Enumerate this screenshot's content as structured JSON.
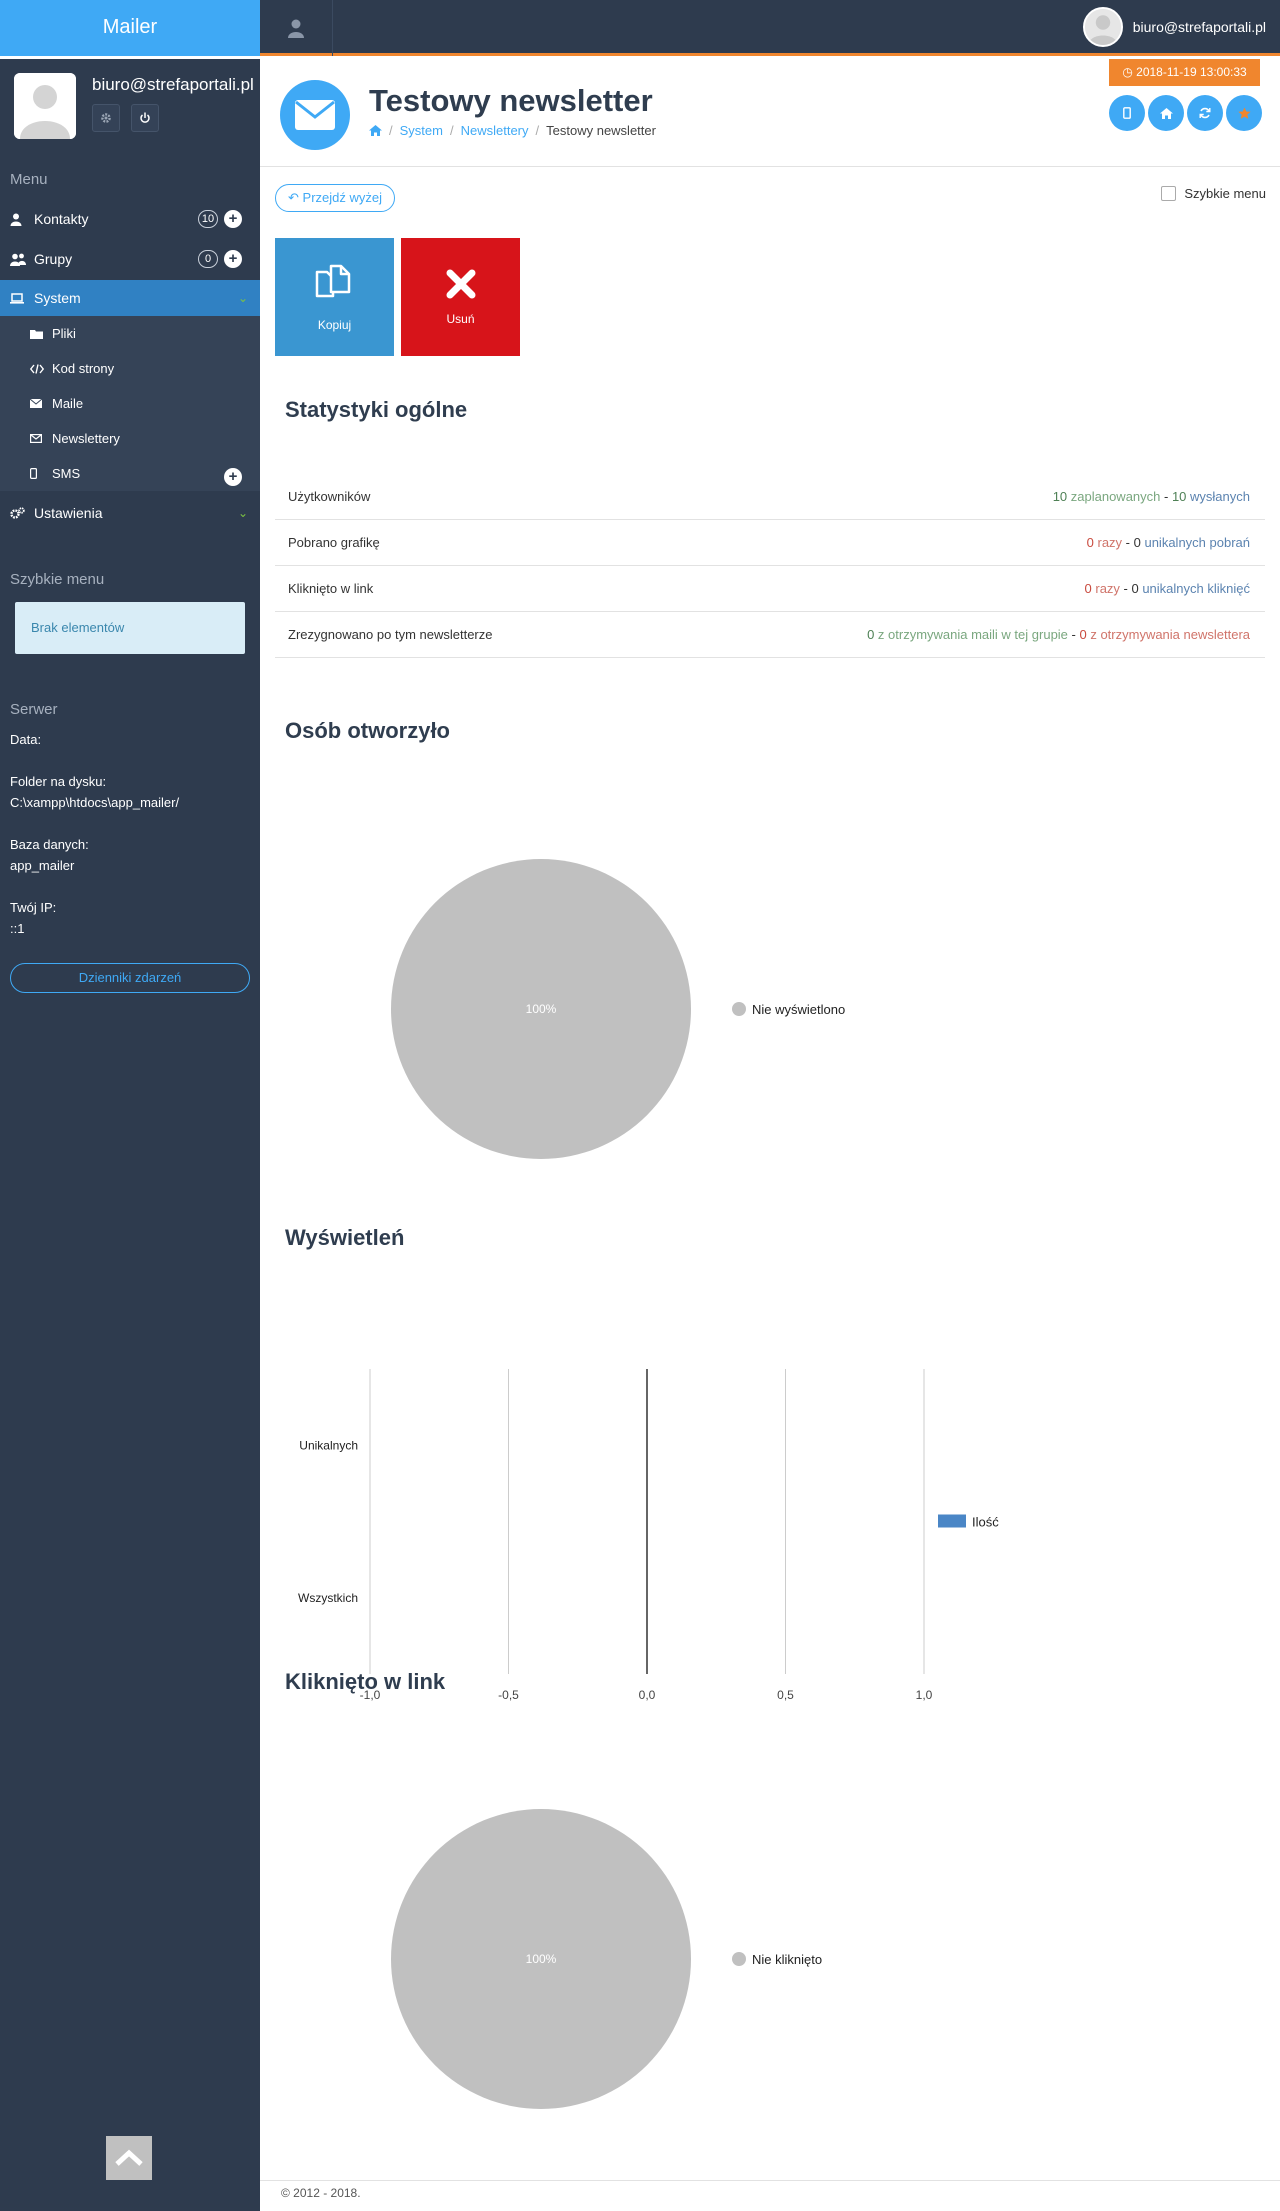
{
  "app": {
    "brand": "Mailer"
  },
  "topbar": {
    "user_email": "biuro@strefaportali.pl"
  },
  "sidebar": {
    "profile_email": "biuro@strefaportali.pl",
    "menu_heading": "Menu",
    "items": [
      {
        "label": "Kontakty",
        "count": "10",
        "icon": "user-icon"
      },
      {
        "label": "Grupy",
        "count": "0",
        "icon": "users-icon"
      },
      {
        "label": "System",
        "icon": "laptop-icon",
        "active": true
      },
      {
        "label": "Ustawienia",
        "icon": "gears-icon"
      }
    ],
    "system_sub": [
      {
        "label": "Pliki",
        "icon": "folder-icon"
      },
      {
        "label": "Kod strony",
        "icon": "code-icon"
      },
      {
        "label": "Maile",
        "icon": "envelope-icon"
      },
      {
        "label": "Newslettery",
        "icon": "envelope-o-icon"
      },
      {
        "label": "SMS",
        "icon": "mobile-icon"
      }
    ],
    "quick_heading": "Szybkie menu",
    "quick_empty": "Brak elementów",
    "server_heading": "Serwer",
    "server": {
      "data_label": "Data:",
      "folder_label": "Folder na dysku:",
      "folder_value": "C:\\xampp\\htdocs\\app_mailer/",
      "db_label": "Baza danych:",
      "db_value": "app_mailer",
      "ip_label": "Twój IP:",
      "ip_value": "::1"
    },
    "log_button": "Dzienniki zdarzeń"
  },
  "header": {
    "title": "Testowy newsletter",
    "breadcrumb": [
      "System",
      "Newslettery",
      "Testowy newsletter"
    ],
    "date": "2018-11-19 13:00:33",
    "buttons": [
      "mobile-icon",
      "home-icon",
      "refresh-icon",
      "star-icon"
    ]
  },
  "toolbar": {
    "back_label": "Przejdź wyżej",
    "quick_menu_label": "Szybkie menu",
    "copy_label": "Kopiuj",
    "delete_label": "Usuń"
  },
  "stats": {
    "title": "Statystyki ogólne",
    "rows": [
      {
        "label": "Użytkowników",
        "v1": "10",
        "t1": " zaplanowanych",
        "sep": " - ",
        "v2": "10",
        "t2": " wysłanych"
      },
      {
        "label": "Pobrano grafikę",
        "v1": "0",
        "t1": " razy",
        "sep": " - ",
        "v2": "0",
        "t2": " unikalnych pobrań"
      },
      {
        "label": "Kliknięto w link",
        "v1": "0",
        "t1": " razy",
        "sep": " - ",
        "v2": "0",
        "t2": " unikalnych kliknięć"
      },
      {
        "label": "Zrezygnowano po tym newsletterze",
        "v1": "0",
        "t1": " z otrzymywania maili w tej grupie",
        "sep": " - ",
        "v2": "0",
        "t2": " z otrzymywania newslettera"
      }
    ]
  },
  "sections": {
    "opened": "Osób otworzyło",
    "views": "Wyświetleń",
    "clicked": "Kliknięto w link"
  },
  "chart_data": [
    {
      "type": "pie",
      "title": "Osób otworzyło",
      "slices": [
        {
          "label": "Nie wyświetlono",
          "value": 100,
          "display": "100%",
          "color": "#c0c0c0"
        }
      ],
      "legend": "right"
    },
    {
      "type": "bar",
      "orientation": "horizontal",
      "title": "Wyświetleń",
      "categories": [
        "Unikalnych",
        "Wszystkich"
      ],
      "series": [
        {
          "name": "Ilość",
          "values": [
            0,
            0
          ],
          "color": "#4a86c6"
        }
      ],
      "xlim": [
        -1.0,
        1.0
      ],
      "ticks": [
        "-1,0",
        "-0,5",
        "0,0",
        "0,5",
        "1,0"
      ],
      "tick_values": [
        -1.0,
        -0.5,
        0.0,
        0.5,
        1.0
      ],
      "grid": true,
      "legend": "right"
    },
    {
      "type": "pie",
      "title": "Kliknięto w link",
      "slices": [
        {
          "label": "Nie kliknięto",
          "value": 100,
          "display": "100%",
          "color": "#c0c0c0"
        }
      ],
      "legend": "right"
    }
  ],
  "footer": {
    "copyright": "© 2012 - 2018."
  }
}
